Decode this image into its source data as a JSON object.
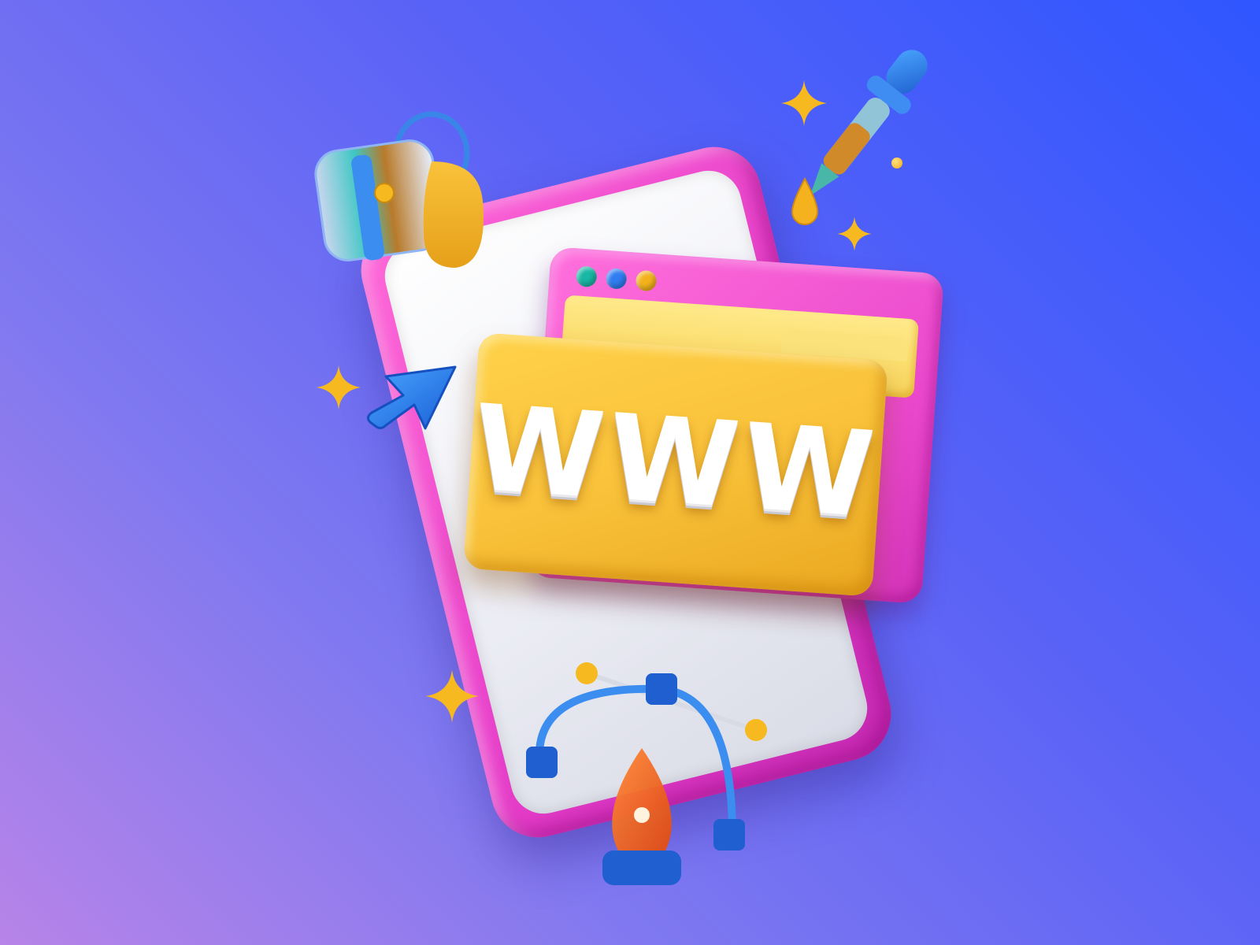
{
  "browser": {
    "window_dots": [
      "green-dot",
      "blue-dot",
      "orange-dot"
    ]
  },
  "folder": {
    "label": "WWW"
  },
  "colors": {
    "background_start": "#b784e8",
    "background_end": "#2f56ff",
    "phone_frame": "#e43cc8",
    "folder": "#f9c23a",
    "accent_blue": "#2f7df0",
    "accent_teal": "#19b8a4",
    "sparkle": "#f6b91f"
  },
  "icons": [
    "paint-bucket-icon",
    "color-dropper-icon",
    "sparkle-icon",
    "cursor-arrow-icon",
    "pen-tool-icon",
    "bezier-curve-icon"
  ]
}
